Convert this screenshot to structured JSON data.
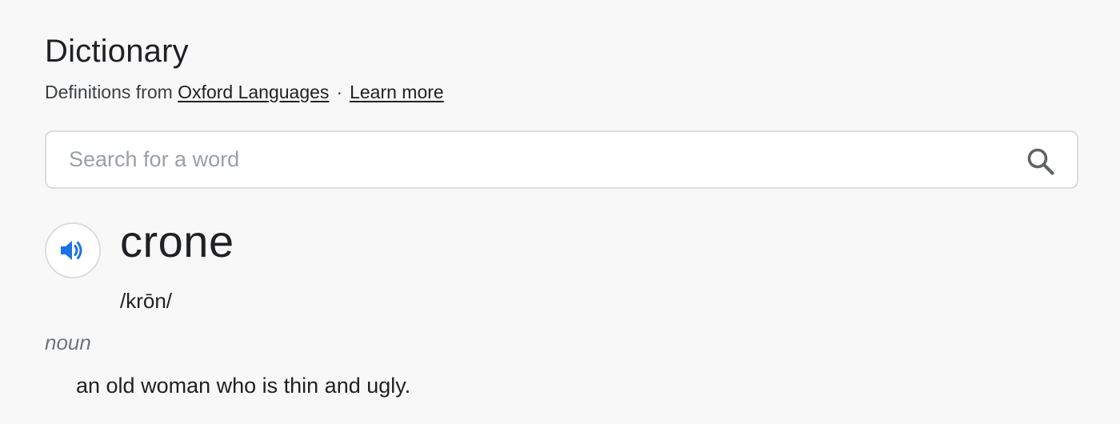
{
  "header": {
    "title": "Dictionary",
    "subtitle_prefix": "Definitions from",
    "source_link": "Oxford Languages",
    "separator": "·",
    "learn_more_link": "Learn more"
  },
  "search": {
    "placeholder": "Search for a word",
    "value": "",
    "icon": "search-icon"
  },
  "entry": {
    "audio_icon": "speaker-icon",
    "word": "crone",
    "pronunciation": "/krōn/",
    "part_of_speech": "noun",
    "definition": "an old woman who is thin and ugly."
  },
  "colors": {
    "accent": "#1a73e8",
    "muted": "#70757a",
    "border": "#dadce0"
  }
}
